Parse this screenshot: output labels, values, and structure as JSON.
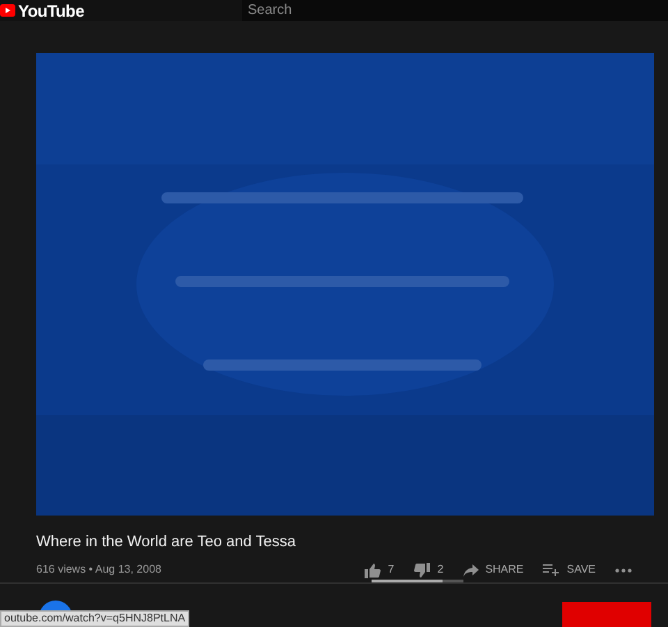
{
  "header": {
    "logo": "YouTube",
    "search": {
      "placeholder": "Search"
    }
  },
  "video": {
    "kind": "picture",
    "title": "Where in the World are Teo and Tessa",
    "meta": "616 views • Aug 13, 2008"
  },
  "actions": [
    {
      "kind": "like",
      "label": "7"
    },
    {
      "kind": "dislike",
      "label": "2"
    },
    {
      "kind": "share",
      "label": "SHARE"
    },
    {
      "kind": "save",
      "label": "SAVE"
    },
    {
      "kind": "more"
    }
  ],
  "rating": {
    "level": 0.78
  },
  "status_url": "outube.com/watch?v=q5HNJ8PtLNA"
}
